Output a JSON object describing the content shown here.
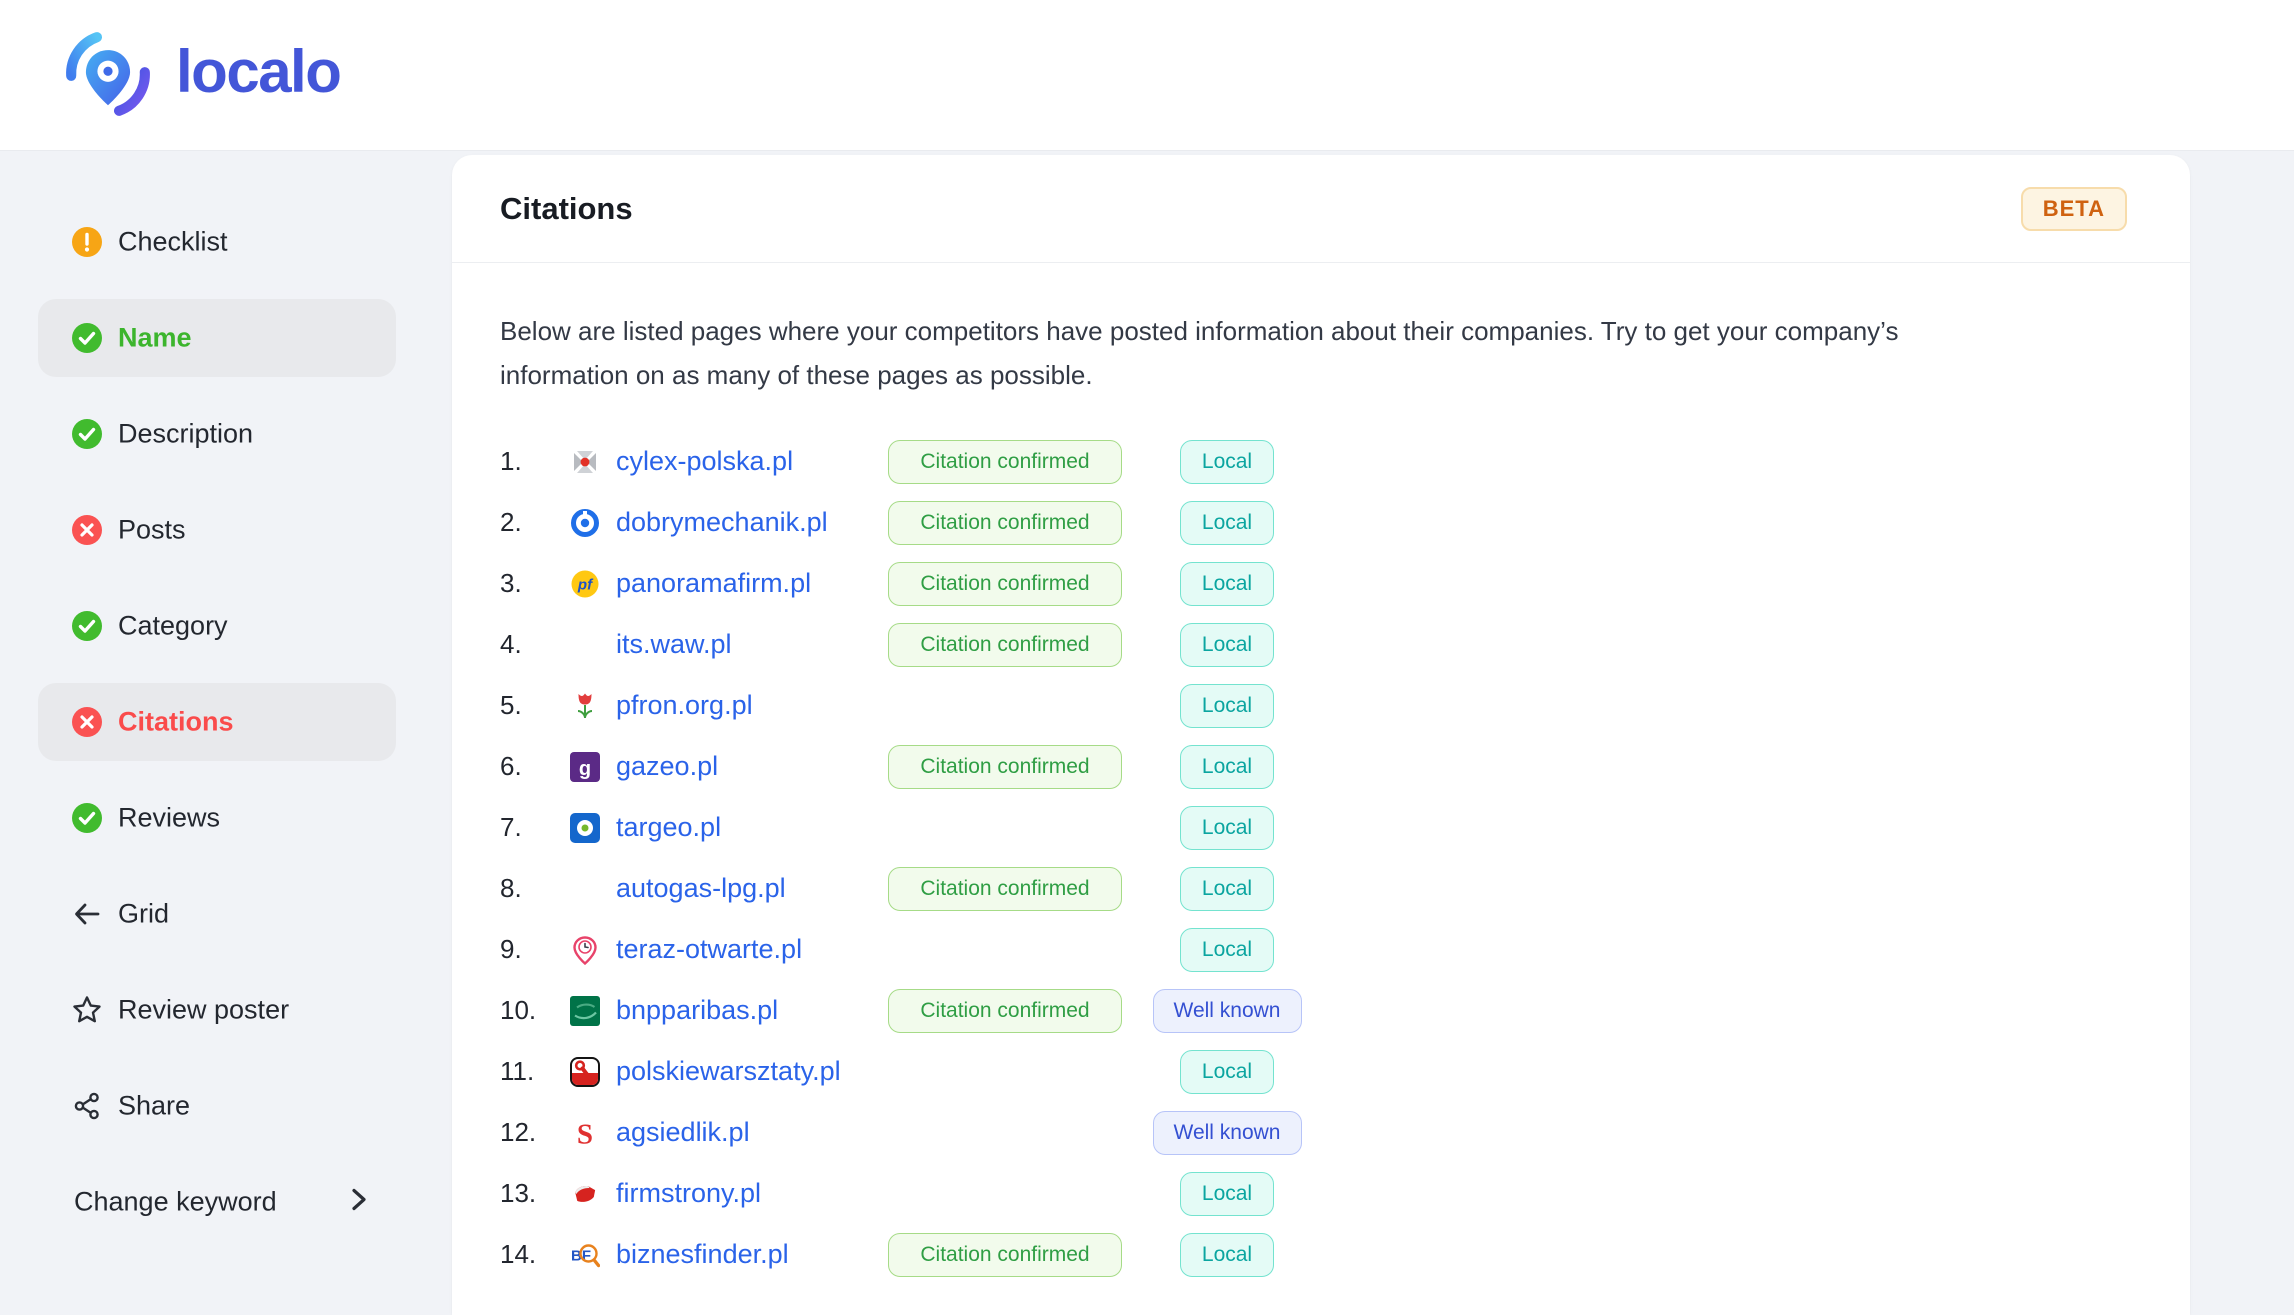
{
  "brand": {
    "name": "localo",
    "logo_icon": "localo-pin-icon"
  },
  "sidebar": {
    "items": [
      {
        "label": "Checklist",
        "icon": "warning-circle-icon",
        "active": false
      },
      {
        "label": "Name",
        "icon": "check-circle-icon",
        "active": true,
        "label_color": "#3cb52d"
      },
      {
        "label": "Description",
        "icon": "check-circle-icon",
        "active": false
      },
      {
        "label": "Posts",
        "icon": "x-circle-icon",
        "active": false
      },
      {
        "label": "Category",
        "icon": "check-circle-icon",
        "active": false
      },
      {
        "label": "Citations",
        "icon": "x-circle-icon",
        "active": true,
        "label_color": "#fa4b4b"
      },
      {
        "label": "Reviews",
        "icon": "check-circle-icon",
        "active": false
      },
      {
        "label": "Grid",
        "icon": "arrow-left-icon",
        "active": false
      },
      {
        "label": "Review poster",
        "icon": "star-icon",
        "active": false
      },
      {
        "label": "Share",
        "icon": "share-icon",
        "active": false
      }
    ],
    "footer": {
      "label": "Change keyword",
      "icon": "chevron-right-icon"
    }
  },
  "main": {
    "title": "Citations",
    "beta_badge": "BETA",
    "description_lines": [
      "Below are listed pages where your competitors have posted information about their companies. Try to get your company’s",
      "information on as many of these pages as possible."
    ],
    "citation_badge_label": "Citation confirmed",
    "scope_labels": {
      "local": "Local",
      "well_known": "Well known"
    },
    "rows": [
      {
        "num": "1.",
        "domain": "cylex-polska.pl",
        "favicon": "cylex",
        "citation_confirmed": true,
        "scope": "Local"
      },
      {
        "num": "2.",
        "domain": "dobrymechanik.pl",
        "favicon": "dobrymechanik",
        "citation_confirmed": true,
        "scope": "Local"
      },
      {
        "num": "3.",
        "domain": "panoramafirm.pl",
        "favicon": "panoramafirm",
        "citation_confirmed": true,
        "scope": "Local"
      },
      {
        "num": "4.",
        "domain": "its.waw.pl",
        "favicon": "none",
        "citation_confirmed": true,
        "scope": "Local"
      },
      {
        "num": "5.",
        "domain": "pfron.org.pl",
        "favicon": "pfron",
        "citation_confirmed": false,
        "scope": "Local"
      },
      {
        "num": "6.",
        "domain": "gazeo.pl",
        "favicon": "gazeo",
        "citation_confirmed": true,
        "scope": "Local"
      },
      {
        "num": "7.",
        "domain": "targeo.pl",
        "favicon": "targeo",
        "citation_confirmed": false,
        "scope": "Local"
      },
      {
        "num": "8.",
        "domain": "autogas-lpg.pl",
        "favicon": "none",
        "citation_confirmed": true,
        "scope": "Local"
      },
      {
        "num": "9.",
        "domain": "teraz-otwarte.pl",
        "favicon": "teraz",
        "citation_confirmed": false,
        "scope": "Local"
      },
      {
        "num": "10.",
        "domain": "bnpparibas.pl",
        "favicon": "bnp",
        "citation_confirmed": true,
        "scope": "Well known"
      },
      {
        "num": "11.",
        "domain": "polskiewarsztaty.pl",
        "favicon": "warsztaty",
        "citation_confirmed": false,
        "scope": "Local"
      },
      {
        "num": "12.",
        "domain": "agsiedlik.pl",
        "favicon": "agsiedlik",
        "citation_confirmed": false,
        "scope": "Well known"
      },
      {
        "num": "13.",
        "domain": "firmstrony.pl",
        "favicon": "firmstrony",
        "citation_confirmed": false,
        "scope": "Local"
      },
      {
        "num": "14.",
        "domain": "biznesfinder.pl",
        "favicon": "biznesfinder",
        "citation_confirmed": true,
        "scope": "Local"
      }
    ]
  },
  "colors": {
    "brand_blue": "#4356d8",
    "link_blue": "#2a63e9",
    "success_green": "#41bb2e",
    "error_red": "#fa5252",
    "warning_orange": "#f7a515",
    "active_name_green": "#3cb52d",
    "active_citations_red": "#fa4b4b",
    "citation_badge_text": "#2f9e44",
    "local_badge_text": "#0ba5a0",
    "well_known_badge_text": "#3450d2",
    "beta_badge_text": "#cf6210",
    "page_background": "#f1f3f7",
    "sidebar_highlight": "#e8e9ec"
  }
}
